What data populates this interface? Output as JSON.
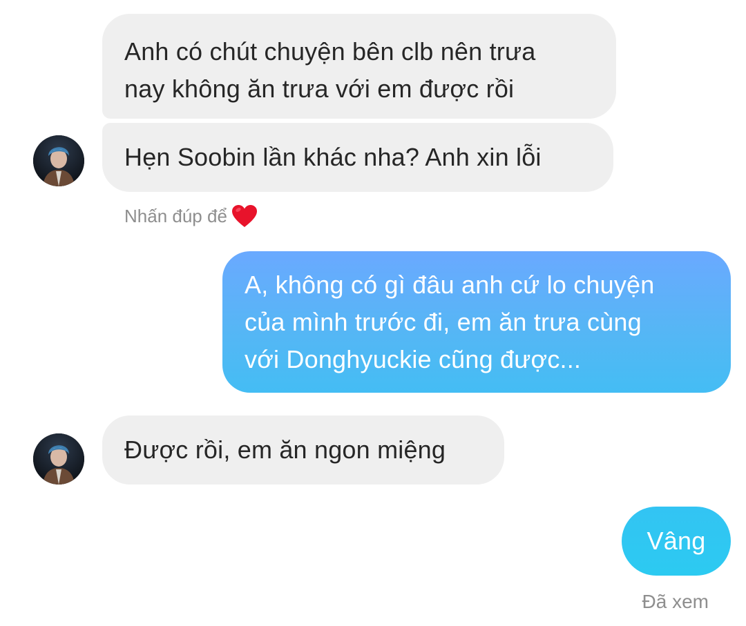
{
  "conversation": {
    "messages": [
      {
        "sender": "other",
        "lines": [
          "Anh có chút chuyện bên clb nên trưa",
          "nay không ăn trưa với em được rồi"
        ]
      },
      {
        "sender": "other",
        "lines": [
          "Hẹn Soobin lần khác nha? Anh xin lỗi"
        ]
      },
      {
        "sender": "me",
        "lines": [
          "A, không có gì đâu anh cứ lo chuyện",
          "của mình trước đi, em ăn trưa cùng",
          "với Donghyuckie cũng được..."
        ]
      },
      {
        "sender": "other",
        "lines": [
          "Được rồi, em ăn ngon miệng"
        ]
      },
      {
        "sender": "me",
        "lines": [
          "Vâng"
        ]
      }
    ],
    "double_tap_hint": "Nhấn đúp để",
    "double_tap_icon": "heart-icon",
    "seen_status": "Đã xem"
  },
  "colors": {
    "received_bubble": "#efefef",
    "sent_gradient_top": "#6aa9ff",
    "sent_gradient_mid": "#56b6f5",
    "sent_gradient_bottom": "#2cc9f2",
    "heart": "#e8132b"
  }
}
